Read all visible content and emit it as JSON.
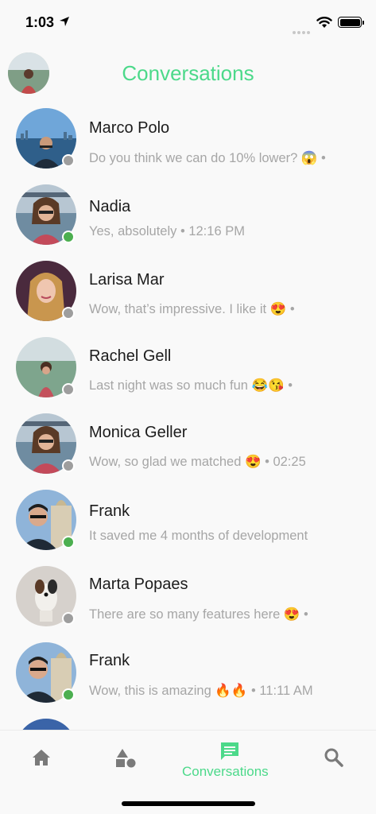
{
  "status_bar": {
    "time": "1:03",
    "icons": [
      "location-arrow-icon",
      "signal-dots-icon",
      "wifi-icon",
      "battery-icon"
    ]
  },
  "header": {
    "title": "Conversations",
    "avatar_icon": "profile-avatar"
  },
  "conversations": [
    {
      "name": "Marco Polo",
      "preview": "Do you think we can do 10% lower? 😱 •",
      "online": false
    },
    {
      "name": "Nadia",
      "preview": "Yes, absolutely • 12:16 PM",
      "online": true
    },
    {
      "name": "Larisa Mar",
      "preview": "Wow, that’s impressive. I like it 😍 •",
      "online": false
    },
    {
      "name": "Rachel Gell",
      "preview": "Last night was so much fun 😂😘 •",
      "online": false
    },
    {
      "name": "Monica Geller",
      "preview": "Wow, so glad we matched 😍 • 02:25",
      "online": false
    },
    {
      "name": "Frank",
      "preview": "It saved me 4 months of development",
      "online": true
    },
    {
      "name": "Marta Popaes",
      "preview": "There are so many features here 😍 •",
      "online": false
    },
    {
      "name": "Frank",
      "preview": "Wow, this is amazing 🔥🔥 • 11:11 AM",
      "online": true
    }
  ],
  "tab_bar": {
    "tabs": [
      {
        "icon": "home-icon",
        "label": ""
      },
      {
        "icon": "shapes-icon",
        "label": ""
      },
      {
        "icon": "chat-icon",
        "label": "Conversations",
        "active": true
      },
      {
        "icon": "search-icon",
        "label": ""
      }
    ]
  },
  "colors": {
    "accent": "#4cd98a",
    "online": "#4caf50",
    "offline": "#9e9e9e",
    "inactive_icon": "#7a7a7a"
  }
}
